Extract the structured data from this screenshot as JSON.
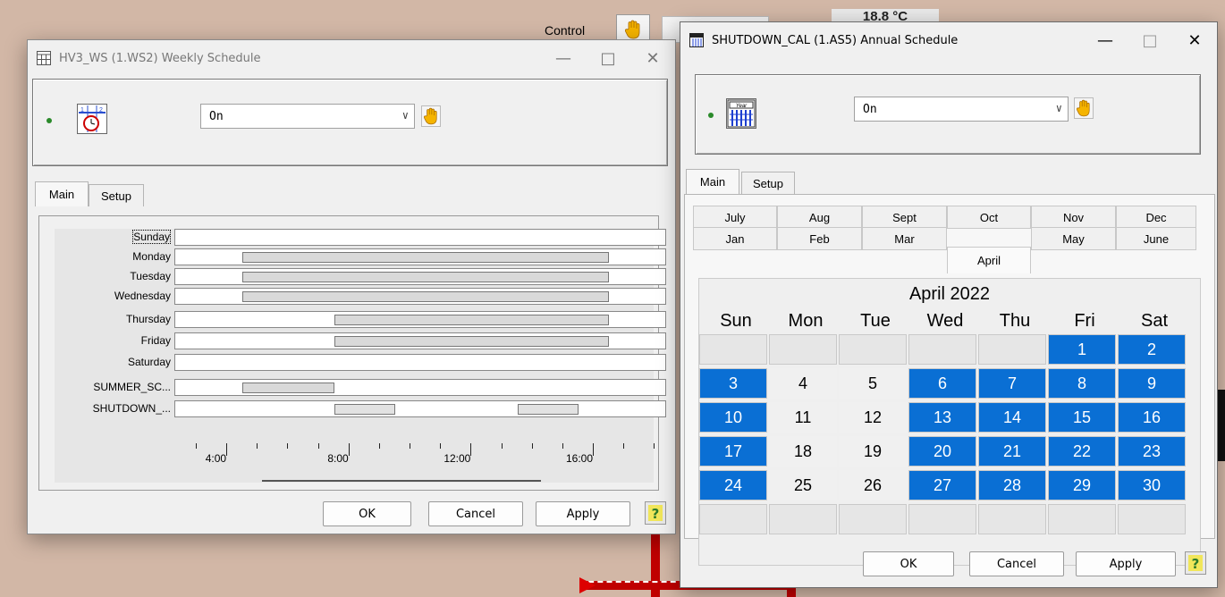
{
  "background": {
    "control_label": "Control",
    "temperature": "18.8 °C"
  },
  "weekly": {
    "title": "HV3_WS  (1.WS2)  Weekly Schedule",
    "combo_value": "On",
    "tabs": [
      "Main",
      "Setup"
    ],
    "rows": [
      {
        "label": "Sunday",
        "segments": []
      },
      {
        "label": "Monday",
        "segments": [
          [
            4.5,
            16.5
          ]
        ]
      },
      {
        "label": "Tuesday",
        "segments": [
          [
            4.5,
            16.5
          ]
        ]
      },
      {
        "label": "Wednesday",
        "segments": [
          [
            4.5,
            16.5
          ]
        ]
      },
      {
        "label": "Thursday",
        "segments": [
          [
            7.5,
            16.5
          ]
        ]
      },
      {
        "label": "Friday",
        "segments": [
          [
            7.5,
            16.5
          ]
        ]
      },
      {
        "label": "Saturday",
        "segments": []
      },
      {
        "label": "SUMMER_SC...",
        "segments": [
          [
            4.5,
            7.5
          ]
        ]
      },
      {
        "label": "SHUTDOWN_...",
        "segments": [
          [
            7.5,
            9.5
          ],
          [
            13.5,
            15.5
          ]
        ]
      }
    ],
    "time_labels": [
      "4:00",
      "8:00",
      "12:00",
      "16:00"
    ],
    "buttons": {
      "ok": "OK",
      "cancel": "Cancel",
      "apply": "Apply"
    }
  },
  "annual": {
    "title": "SHUTDOWN_CAL  (1.AS5)  Annual Schedule",
    "combo_value": "On",
    "tabs": [
      "Main",
      "Setup"
    ],
    "months_row1": [
      "July",
      "Aug",
      "Sept",
      "Oct",
      "Nov",
      "Dec"
    ],
    "months_row2": [
      "Jan",
      "Feb",
      "Mar",
      "April",
      "May",
      "June"
    ],
    "active_month": "April",
    "calendar_title": "April 2022",
    "weekdays": [
      "Sun",
      "Mon",
      "Tue",
      "Wed",
      "Thu",
      "Fri",
      "Sat"
    ],
    "first_weekday_index": 5,
    "days_in_month": 30,
    "on_days": [
      1,
      2,
      3,
      6,
      7,
      8,
      9,
      10,
      13,
      14,
      15,
      16,
      17,
      20,
      21,
      22,
      23,
      24,
      27,
      28,
      29,
      30
    ],
    "buttons": {
      "ok": "OK",
      "cancel": "Cancel",
      "apply": "Apply"
    }
  },
  "colors": {
    "selected_day": "#0a6fd4",
    "background": "#d2b7a6"
  },
  "icons": [
    "weekly-schedule-icon",
    "annual-schedule-icon",
    "manual-hand-icon",
    "help-icon",
    "chevron-down-icon",
    "minimize-icon",
    "maximize-icon",
    "close-icon"
  ]
}
